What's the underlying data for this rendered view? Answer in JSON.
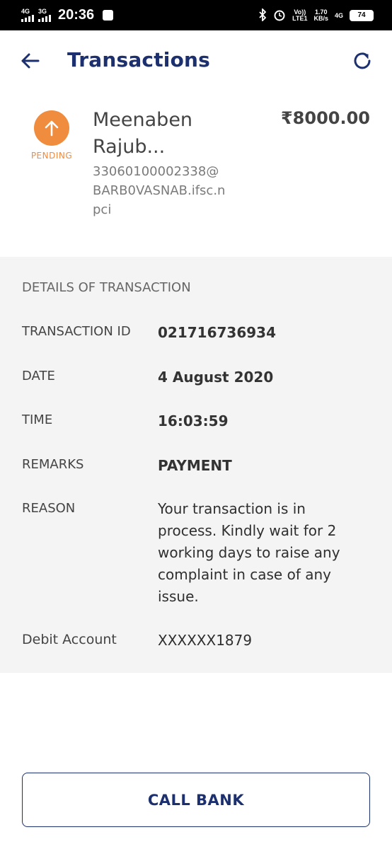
{
  "status_bar": {
    "net1": "4G",
    "net2": "3G",
    "time": "20:36",
    "volte": "Vo))",
    "lte": "LTE1",
    "speed": "1.70",
    "speed_unit": "KB/s",
    "net3": "4G",
    "battery": "74"
  },
  "header": {
    "title": "Transactions"
  },
  "summary": {
    "status": "PENDING",
    "payee_name": "Meenaben Rajub...",
    "vpa": "33060100002338@BARB0VASNAB.ifsc.npci",
    "amount": "₹8000.00"
  },
  "details": {
    "heading": "DETAILS OF TRANSACTION",
    "rows": [
      {
        "label": "TRANSACTION ID",
        "value": "021716736934"
      },
      {
        "label": "DATE",
        "value": "4 August 2020"
      },
      {
        "label": "TIME",
        "value": "16:03:59"
      },
      {
        "label": "REMARKS",
        "value": "PAYMENT"
      },
      {
        "label": "REASON",
        "value": "Your transaction is in process. Kindly wait for 2 working days to raise any complaint in case of any issue."
      },
      {
        "label": "Debit Account",
        "value": "XXXXXX1879"
      }
    ]
  },
  "actions": {
    "call_bank": "CALL BANK"
  },
  "colors": {
    "primary": "#1c2f6e",
    "pending": "#f08c3e",
    "details_bg": "#f4f4f4"
  }
}
